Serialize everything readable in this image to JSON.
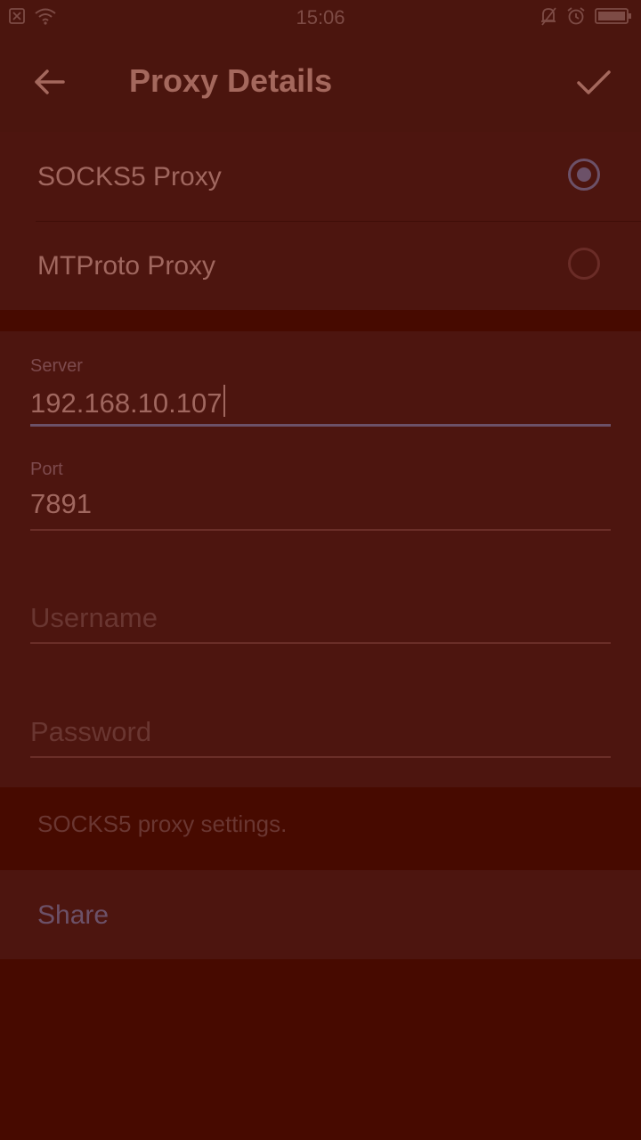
{
  "status_bar": {
    "time": "15:06",
    "left_icons": [
      "sim-off-icon",
      "wifi-icon"
    ],
    "right_icons": [
      "bell-off-icon",
      "alarm-icon",
      "battery-icon"
    ]
  },
  "app_bar": {
    "back_icon": "arrow-left-icon",
    "title": "Proxy Details",
    "done_icon": "checkmark-icon"
  },
  "proxy_types": [
    {
      "label": "SOCKS5 Proxy",
      "selected": true
    },
    {
      "label": "MTProto Proxy",
      "selected": false
    }
  ],
  "fields": {
    "server": {
      "label": "Server",
      "value": "192.168.10.107"
    },
    "port": {
      "label": "Port",
      "value": "7891"
    },
    "username": {
      "placeholder": "Username"
    },
    "password": {
      "placeholder": "Password"
    }
  },
  "hint_text": "SOCKS5 proxy settings.",
  "share_label": "Share",
  "colors": {
    "background": "#470a00",
    "accent": "#6c5168",
    "text": "#a0675f"
  }
}
